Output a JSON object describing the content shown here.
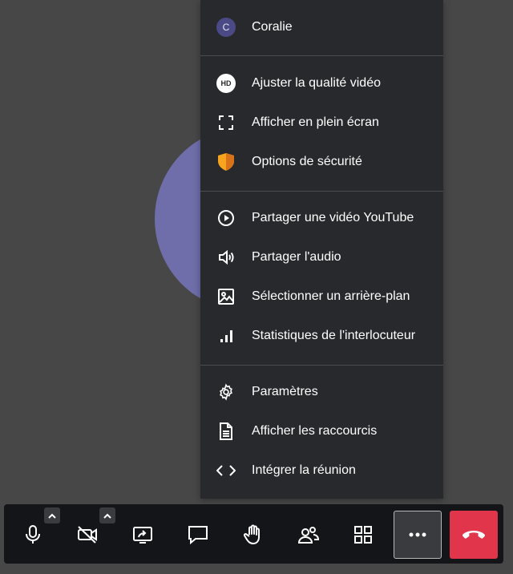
{
  "user_menu": {
    "name": "Coralie",
    "initial": "C",
    "items": [
      {
        "label": "Ajuster la qualité vidéo",
        "icon": "hd-icon",
        "badge": "HD"
      },
      {
        "label": "Afficher en plein écran",
        "icon": "fullscreen-icon"
      },
      {
        "label": "Options de sécurité",
        "icon": "security-shield-icon"
      },
      {
        "label": "Partager une vidéo YouTube",
        "icon": "play-circle-icon"
      },
      {
        "label": "Partager l'audio",
        "icon": "speaker-icon"
      },
      {
        "label": "Sélectionner un arrière-plan",
        "icon": "image-icon"
      },
      {
        "label": "Statistiques de l'interlocuteur",
        "icon": "signal-bars-icon"
      },
      {
        "label": "Paramètres",
        "icon": "gear-icon"
      },
      {
        "label": "Afficher les raccourcis",
        "icon": "document-icon"
      },
      {
        "label": "Intégrer la réunion",
        "icon": "code-icon"
      }
    ]
  },
  "toolbar": {
    "buttons": [
      {
        "name": "microphone-button",
        "icon": "microphone-icon"
      },
      {
        "name": "camera-button",
        "icon": "camera-off-icon"
      },
      {
        "name": "share-screen-button",
        "icon": "screen-share-icon"
      },
      {
        "name": "chat-button",
        "icon": "chat-icon"
      },
      {
        "name": "raise-hand-button",
        "icon": "hand-icon"
      },
      {
        "name": "participants-button",
        "icon": "participants-icon"
      },
      {
        "name": "tile-view-button",
        "icon": "grid-icon"
      },
      {
        "name": "more-options-button",
        "icon": "more-icon"
      },
      {
        "name": "hangup-button",
        "icon": "phone-hangup-icon"
      }
    ]
  },
  "colors": {
    "background": "#474747",
    "menu_bg": "#28292c",
    "toolbar_bg": "#131519",
    "hangup": "#e0354a",
    "avatar": "#6f6eaa",
    "shield": "#f7a51e"
  }
}
